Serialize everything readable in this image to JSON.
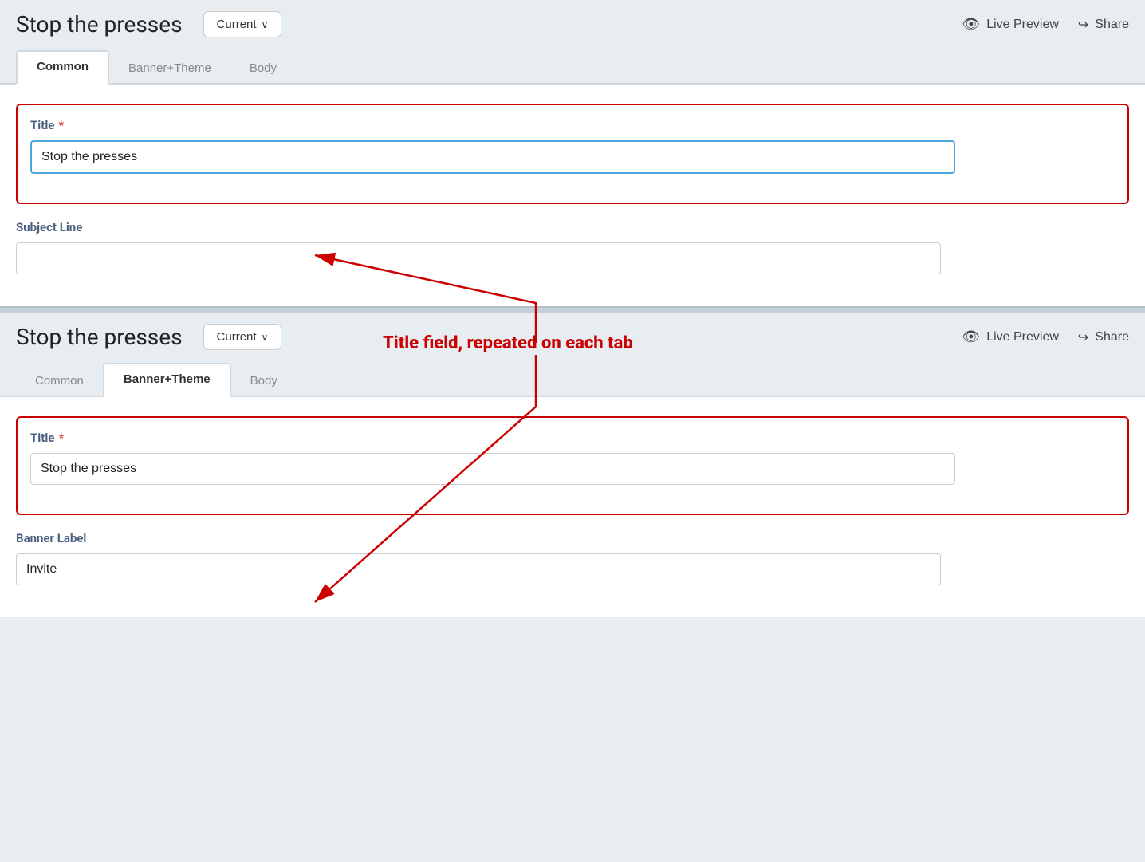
{
  "page": {
    "title": "Stop the presses"
  },
  "header": {
    "title": "Stop the presses",
    "dropdown_label": "Current",
    "live_preview_label": "Live Preview",
    "share_label": "Share"
  },
  "tabs_top": {
    "items": [
      {
        "label": "Common",
        "active": true
      },
      {
        "label": "Banner+Theme",
        "active": false
      },
      {
        "label": "Body",
        "active": false
      }
    ]
  },
  "tabs_bottom": {
    "items": [
      {
        "label": "Common",
        "active": false
      },
      {
        "label": "Banner+Theme",
        "active": true
      },
      {
        "label": "Body",
        "active": false
      }
    ]
  },
  "section_top": {
    "title_field": {
      "label": "Title",
      "required": true,
      "value": "Stop the presses",
      "focused": true
    },
    "subject_line_field": {
      "label": "Subject Line",
      "value": "",
      "placeholder": ""
    }
  },
  "section_bottom": {
    "title_field": {
      "label": "Title",
      "required": true,
      "value": "Stop the presses"
    },
    "banner_label_field": {
      "label": "Banner Label",
      "value": "Invite"
    }
  },
  "annotation": {
    "text": "Title field, repeated on each tab"
  },
  "icons": {
    "eye": "👁",
    "share": "↪",
    "chevron": "∨"
  }
}
